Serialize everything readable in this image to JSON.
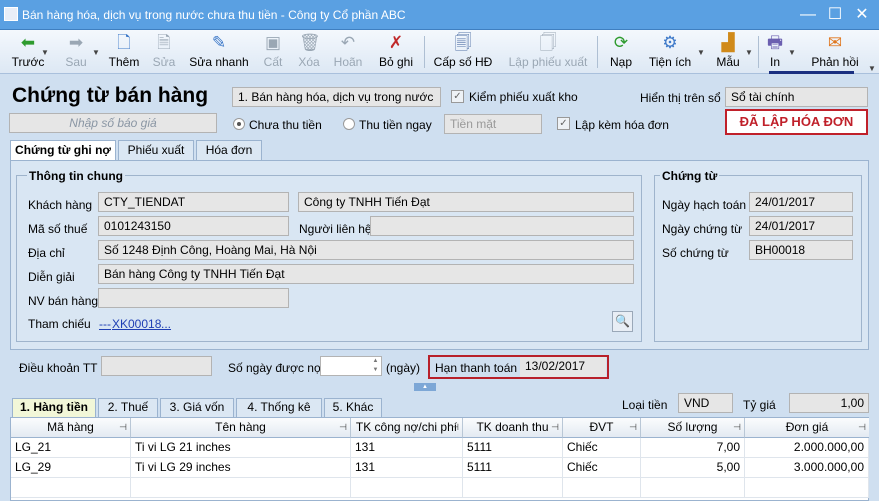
{
  "window": {
    "title": "Bán hàng hóa, dịch vụ trong nước chưa thu tiền - Công ty Cổ phần ABC",
    "btn_min": "—",
    "btn_max": "☐",
    "btn_close": "✕"
  },
  "toolbar": {
    "back": "Trước",
    "next": "Sau",
    "add": "Thêm",
    "edit": "Sửa",
    "quick_edit": "Sửa nhanh",
    "cut": "Cất",
    "delete": "Xóa",
    "undo": "Hoãn",
    "unpost": "Bỏ ghi",
    "invoice_no": "Cấp số HĐ",
    "export_slip": "Lập phiếu xuất",
    "reload": "Nạp",
    "utilities": "Tiện ích",
    "template": "Mẫu",
    "print": "In",
    "feedback": "Phản hồi"
  },
  "header": {
    "title": "Chứng từ bán hàng",
    "sale_type": "1. Bán hàng hóa, dịch vụ trong nước",
    "check_export": "Kiểm phiếu xuất kho",
    "show_on_book_label": "Hiển thị trên sổ",
    "show_on_book_value": "Sổ tài chính",
    "quote_placeholder": "Nhập số báo giá",
    "radio_unpaid": "Chưa thu tiền",
    "radio_paid": "Thu tiền ngay",
    "pay_method": "Tiền mặt",
    "check_invoice": "Lập kèm hóa đơn",
    "invoice_badge": "ĐÃ LẬP HÓA ĐƠN"
  },
  "tabs": [
    "Chứng từ ghi nợ",
    "Phiếu xuất",
    "Hóa đơn"
  ],
  "general": {
    "title": "Thông tin chung",
    "customer_label": "Khách hàng",
    "customer_code": "CTY_TIENDAT",
    "customer_name": "Công ty TNHH Tiến Đạt",
    "tax_label": "Mã số thuế",
    "tax_code": "0101243150",
    "contact_label": "Người liên hệ",
    "contact_value": "",
    "address_label": "Địa chỉ",
    "address": "Số 1248 Định Công, Hoàng Mai, Hà Nội",
    "desc_label": "Diễn giải",
    "desc": "Bán hàng Công ty TNHH Tiến Đạt",
    "seller_label": "NV bán hàng",
    "seller": "",
    "ref_label": "Tham chiếu",
    "ref_prefix": "---",
    "ref_code": "XK00018",
    "ref_more": "..."
  },
  "voucher": {
    "title": "Chứng từ",
    "posting_date_label": "Ngày hạch toán",
    "posting_date": "24/01/2017",
    "voucher_date_label": "Ngày chứng từ",
    "voucher_date": "24/01/2017",
    "voucher_no_label": "Số chứng từ",
    "voucher_no": "BH00018"
  },
  "terms": {
    "term_label": "Điều khoản TT",
    "term_value": "",
    "days_label": "Số ngày được nợ",
    "days_value": "",
    "days_unit": "(ngày)",
    "due_label": "Hạn thanh toán",
    "due_date": "13/02/2017"
  },
  "bottom_tabs": [
    "1. Hàng tiền",
    "2. Thuế",
    "3. Giá vốn",
    "4. Thống kê",
    "5. Khác"
  ],
  "currency": {
    "label": "Loại tiền",
    "value": "VND",
    "rate_label": "Tỷ giá",
    "rate": "1,00"
  },
  "grid": {
    "headers": [
      "Mã hàng",
      "Tên hàng",
      "TK công nợ/chi phí",
      "TK doanh thu",
      "ĐVT",
      "Số lượng",
      "Đơn giá"
    ],
    "rows": [
      [
        "LG_21",
        "Ti vi LG 21 inches",
        "131",
        "5111",
        "Chiếc",
        "7,00",
        "2.000.000,00"
      ],
      [
        "LG_29",
        "Ti vi LG 29 inches",
        "131",
        "5111",
        "Chiếc",
        "5,00",
        "3.000.000,00"
      ]
    ]
  },
  "colors": {
    "titlebar": "#5aa0e2",
    "badge": "#c0202a",
    "link": "#1f3fb4"
  }
}
